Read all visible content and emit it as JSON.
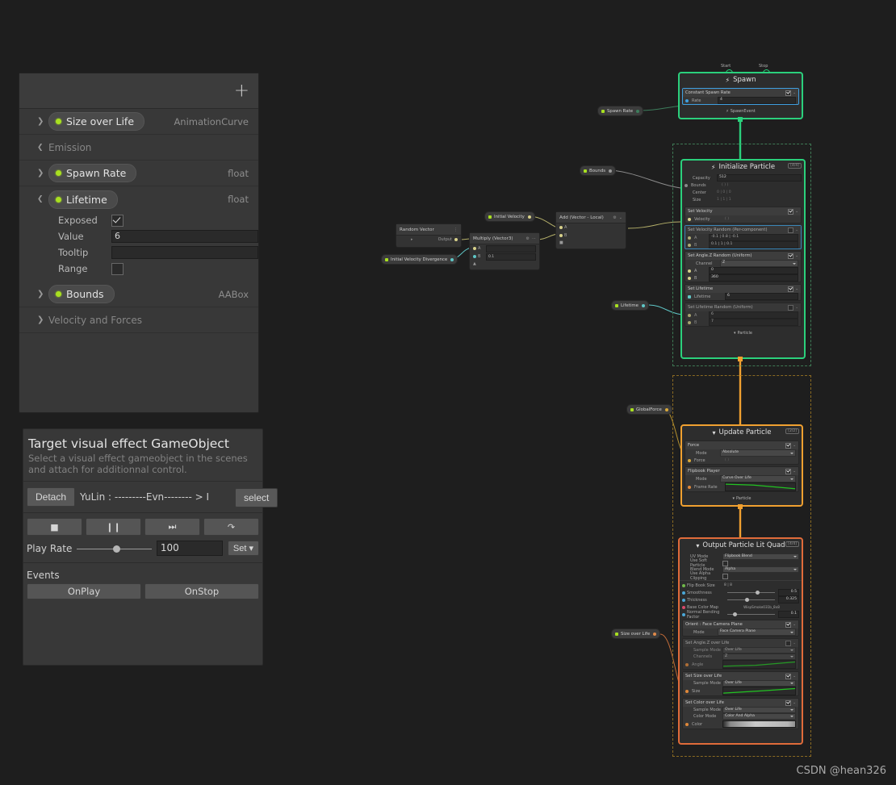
{
  "blackboard": {
    "add_button": "+",
    "rows": [
      {
        "kind": "property",
        "label": "Size over Life",
        "type": "AnimationCurve",
        "expanded": false
      },
      {
        "kind": "category",
        "label": "Emission",
        "expanded": true
      },
      {
        "kind": "property",
        "label": "Spawn Rate",
        "type": "float",
        "expanded": false
      },
      {
        "kind": "property",
        "label": "Lifetime",
        "type": "float",
        "expanded": true
      }
    ],
    "lifetime_fields": [
      {
        "label": "Exposed",
        "kind": "checkbox",
        "checked": true
      },
      {
        "label": "Value",
        "kind": "text",
        "value": "6"
      },
      {
        "label": "Tooltip",
        "kind": "text",
        "value": ""
      },
      {
        "label": "Range",
        "kind": "checkbox",
        "checked": false
      }
    ],
    "bounds_row": {
      "label": "Bounds",
      "type": "AABox"
    },
    "velocity_category": {
      "label": "Velocity and Forces",
      "expanded": false
    }
  },
  "control_panel": {
    "title": "Target visual effect GameObject",
    "description": "Select a visual effect gameobject in the scenes and attach for additionnal control.",
    "detach_label": "Detach",
    "attach_path": "YuLin : ---------Evn-------- > I",
    "select_label": "select",
    "transport": [
      {
        "name": "stop-button",
        "glyph": "■"
      },
      {
        "name": "pause-button",
        "glyph": "❙❙"
      },
      {
        "name": "step-button",
        "glyph": "⏭"
      },
      {
        "name": "restart-button",
        "glyph": "↷"
      }
    ],
    "play_rate_label": "Play Rate",
    "play_rate_value": "100",
    "set_label": "Set ▾",
    "events_label": "Events",
    "events": [
      "OnPlay",
      "OnStop"
    ]
  },
  "graph": {
    "property_nodes": [
      {
        "name": "spawn-rate",
        "label": "Spawn Rate"
      },
      {
        "name": "bounds",
        "label": "Bounds"
      },
      {
        "name": "initial-velocity",
        "label": "Initial Velocity"
      },
      {
        "name": "initial-velocity-divergence",
        "label": "Initial Velocity Divergence"
      },
      {
        "name": "lifetime",
        "label": "Lifetime"
      },
      {
        "name": "global-force",
        "label": "GlobalForce"
      },
      {
        "name": "size-over-life",
        "label": "Size over Life"
      }
    ],
    "operators": [
      {
        "name": "random-vector",
        "title": "Random Vector",
        "rows": [
          {
            "label": "Output"
          }
        ]
      },
      {
        "name": "multiply-vector3",
        "title": "Multiply (Vector3)",
        "rows": [
          {
            "label": "A",
            "value": ""
          },
          {
            "label": "B",
            "value": "0.1"
          }
        ]
      },
      {
        "name": "add-vector-local",
        "title": "Add (Vector - Local)",
        "rows": [
          {
            "label": "A"
          },
          {
            "label": "B"
          }
        ]
      }
    ],
    "contexts": [
      {
        "name": "spawn",
        "title": "Spawn",
        "accent": "#2bd07c",
        "flow_in_labels": [
          "Start",
          "Stop"
        ],
        "flow_out": "SpawnEvent",
        "blocks": [
          {
            "title": "Constant Spawn Rate",
            "enabled": true,
            "props": [
              {
                "label": "Rate",
                "value": "4",
                "kind": "field"
              }
            ]
          }
        ]
      },
      {
        "name": "initialize-particle",
        "title": "Initialize Particle",
        "accent": "#2bd07c",
        "badge": "[4/4]",
        "flow_out": "Particle",
        "header_props": [
          {
            "label": "Capacity",
            "value": "512",
            "kind": "field"
          },
          {
            "label": "Bounds",
            "value": "( ) )",
            "kind": "plain"
          },
          {
            "label": "Center",
            "value": "0 | 0 | 0",
            "kind": "vec"
          },
          {
            "label": "Size",
            "value": "1 | 1 | 1",
            "kind": "vec"
          }
        ],
        "blocks": [
          {
            "title": "Set Velocity",
            "enabled": true,
            "props": [
              {
                "label": "Velocity",
                "value": "( )",
                "kind": "field"
              }
            ]
          },
          {
            "title": "Set Velocity Random (Per-component)",
            "enabled": false,
            "props": [
              {
                "label": "A",
                "value": "-0.1 | 0.8 | -0.1",
                "kind": "vec"
              },
              {
                "label": "B",
                "value": "0.1 | 1 | 0.1",
                "kind": "vec"
              }
            ]
          },
          {
            "title": "Set Angle.Z Random (Uniform)",
            "enabled": true,
            "props": [
              {
                "label": "Channel",
                "value": "Z",
                "kind": "dropdown"
              },
              {
                "label": "A",
                "value": "0",
                "kind": "field"
              },
              {
                "label": "B",
                "value": "360",
                "kind": "field"
              }
            ]
          },
          {
            "title": "Set Lifetime",
            "enabled": true,
            "props": [
              {
                "label": "Lifetime",
                "value": "6",
                "kind": "field"
              }
            ]
          },
          {
            "title": "Set Lifetime Random (Uniform)",
            "enabled": false,
            "props": [
              {
                "label": "A",
                "value": "6",
                "kind": "field"
              },
              {
                "label": "B",
                "value": "7",
                "kind": "field"
              }
            ]
          }
        ]
      },
      {
        "name": "update-particle",
        "title": "Update Particle",
        "accent": "#f0a030",
        "badge": "[2/2]",
        "flow_out": "Particle",
        "blocks": [
          {
            "title": "Force",
            "enabled": true,
            "props": [
              {
                "label": "Mode",
                "value": "Absolute",
                "kind": "dropdown"
              },
              {
                "label": "Force",
                "value": "( )",
                "kind": "field"
              }
            ]
          },
          {
            "title": "Flipbook Player",
            "enabled": true,
            "props": [
              {
                "label": "Mode",
                "value": "Curve Over Life",
                "kind": "dropdown"
              },
              {
                "label": "Frame Rate",
                "value": "",
                "kind": "curve"
              }
            ]
          }
        ]
      },
      {
        "name": "output-particle-lit-quad",
        "title": "Output Particle Lit Quad",
        "accent": "#e06b3a",
        "badge": "[4/4]",
        "header_props": [
          {
            "label": "UV Mode",
            "value": "Flipbook Blend",
            "kind": "dropdown"
          },
          {
            "label": "Use Soft Particle",
            "value": "",
            "kind": "checkbox"
          },
          {
            "label": "Blend Mode",
            "value": "Alpha",
            "kind": "dropdown"
          },
          {
            "label": "Use Alpha Clipping",
            "value": "",
            "kind": "checkbox"
          }
        ],
        "sliders": [
          {
            "label": "Flip Book Size",
            "value": "8 | 8",
            "kind": "vec2"
          },
          {
            "label": "Smoothness",
            "value": "0.5",
            "kind": "slider",
            "pos": 60
          },
          {
            "label": "Thickness",
            "value": "0.325",
            "kind": "slider",
            "pos": 38
          },
          {
            "label": "Base Color Map",
            "value": "WispSmoke031b_8x8",
            "kind": "object"
          },
          {
            "label": "Normal Bending Factor",
            "value": "0.1",
            "kind": "slider",
            "pos": 12
          }
        ],
        "blocks": [
          {
            "title": "Orient : Face Camera Plane",
            "enabled": true,
            "props": [
              {
                "label": "Mode",
                "value": "Face Camera Plane",
                "kind": "dropdown"
              }
            ]
          },
          {
            "title": "Set Angle.Z over Life",
            "enabled": false,
            "props": [
              {
                "label": "Sample Mode",
                "value": "Over Life",
                "kind": "dropdown"
              },
              {
                "label": "Channels",
                "value": "Z",
                "kind": "dropdown"
              },
              {
                "label": "Angle",
                "value": "",
                "kind": "curve"
              }
            ]
          },
          {
            "title": "Set Size over Life",
            "enabled": true,
            "props": [
              {
                "label": "Sample Mode",
                "value": "Over Life",
                "kind": "dropdown"
              },
              {
                "label": "Size",
                "value": "",
                "kind": "curve"
              }
            ]
          },
          {
            "title": "Set Color over Life",
            "enabled": true,
            "props": [
              {
                "label": "Sample Mode",
                "value": "Over Life",
                "kind": "dropdown"
              },
              {
                "label": "Color Mode",
                "value": "Color And Alpha",
                "kind": "dropdown"
              },
              {
                "label": "Color",
                "value": "",
                "kind": "gradient"
              }
            ]
          }
        ]
      }
    ]
  },
  "watermark": "CSDN @hean326",
  "colors": {
    "spawn_accent": "#2bd07c",
    "initialize_accent": "#2bd07c",
    "update_accent": "#f0a030",
    "output_accent": "#e06b3a",
    "property_dot": "#a8e020",
    "curve_green": "#22c322"
  }
}
